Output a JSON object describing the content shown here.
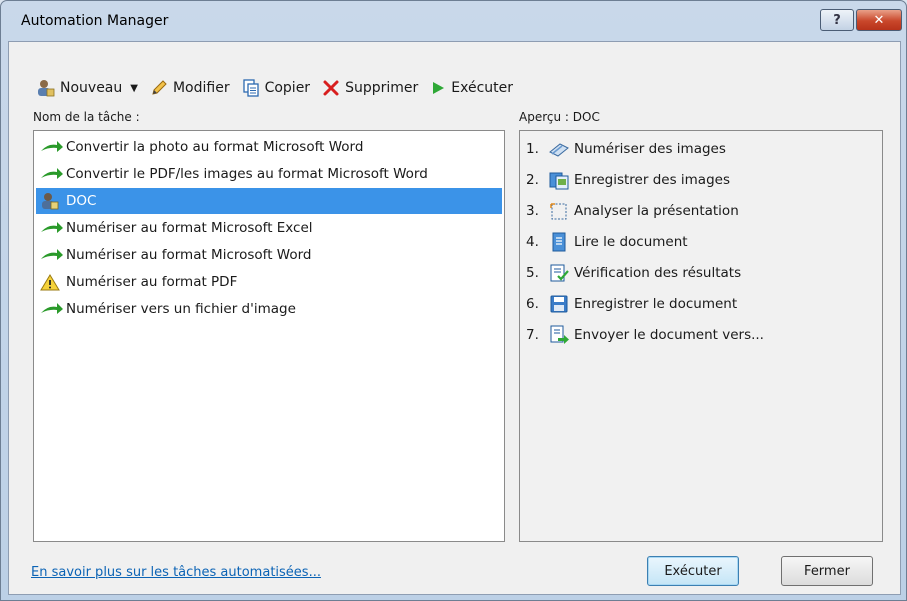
{
  "window": {
    "title": "Automation Manager",
    "help_label": "?",
    "close_label": "✕"
  },
  "toolbar": {
    "new_label": "Nouveau",
    "edit_label": "Modifier",
    "copy_label": "Copier",
    "delete_label": "Supprimer",
    "run_label": "Exécuter"
  },
  "labels": {
    "task_name": "Nom de la tâche :",
    "preview": "Aperçu : DOC"
  },
  "tasks": [
    {
      "label": "Convertir la photo au format Microsoft Word",
      "icon": "green-arrow-icon"
    },
    {
      "label": "Convertir le PDF/les images au format Microsoft Word",
      "icon": "green-arrow-icon"
    },
    {
      "label": "DOC",
      "icon": "user-task-icon",
      "selected": true
    },
    {
      "label": "Numériser au format Microsoft Excel",
      "icon": "green-arrow-icon"
    },
    {
      "label": "Numériser au format Microsoft Word",
      "icon": "green-arrow-icon"
    },
    {
      "label": "Numériser au format PDF",
      "icon": "warning-icon"
    },
    {
      "label": "Numériser vers un fichier d'image",
      "icon": "green-arrow-icon"
    }
  ],
  "steps": [
    {
      "num": "1.",
      "label": "Numériser des images",
      "icon": "scanner-icon"
    },
    {
      "num": "2.",
      "label": "Enregistrer des images",
      "icon": "save-images-icon"
    },
    {
      "num": "3.",
      "label": "Analyser la présentation",
      "icon": "analyze-layout-icon"
    },
    {
      "num": "4.",
      "label": "Lire le document",
      "icon": "read-document-icon"
    },
    {
      "num": "5.",
      "label": "Vérification des résultats",
      "icon": "verify-icon"
    },
    {
      "num": "6.",
      "label": "Enregistrer le document",
      "icon": "floppy-icon"
    },
    {
      "num": "7.",
      "label": "Envoyer le document vers...",
      "icon": "send-document-icon"
    }
  ],
  "footer": {
    "link_label": "En savoir plus sur les tâches automatisées...",
    "run_button": "Exécuter",
    "close_button": "Fermer"
  },
  "colors": {
    "selection": "#3b93e8",
    "link": "#0b63b5",
    "close_button": "#c9472b"
  }
}
